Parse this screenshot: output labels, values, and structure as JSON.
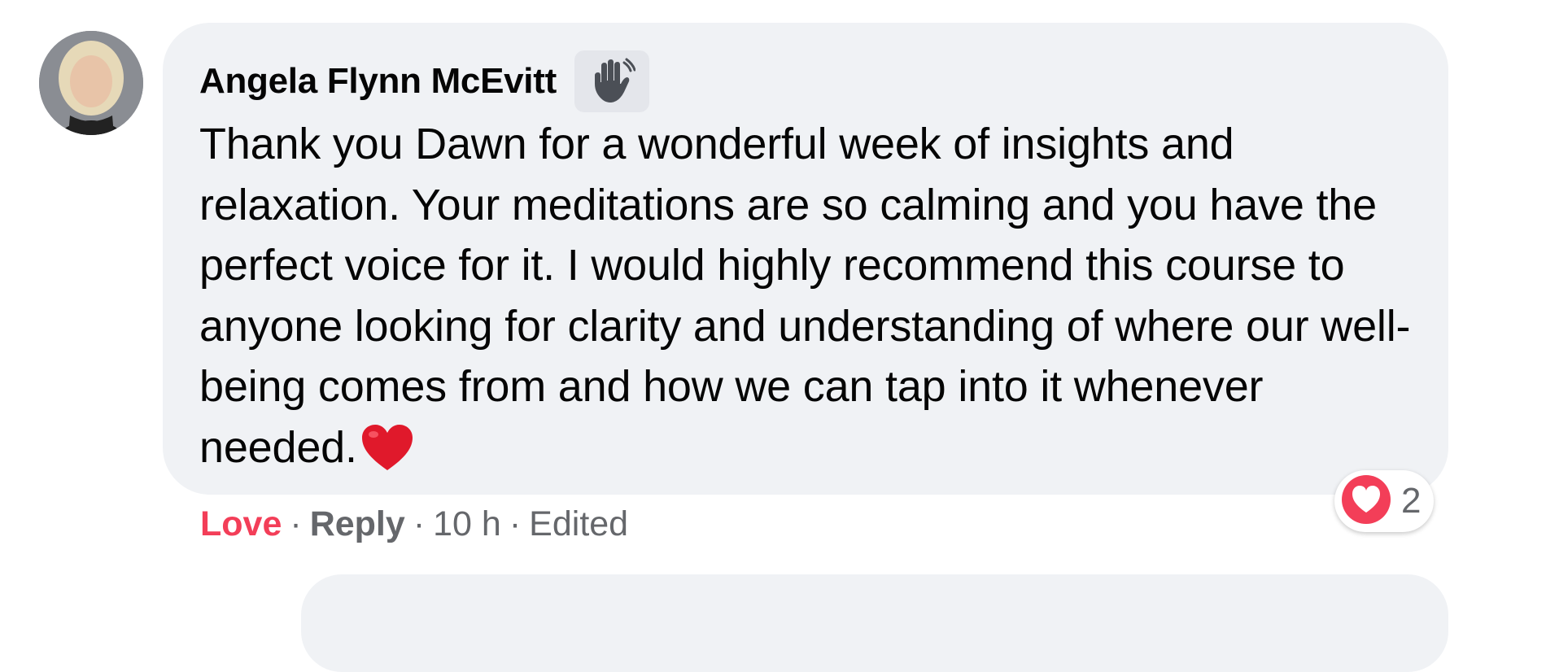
{
  "comment": {
    "author": "Angela Flynn McEvitt",
    "badge_icon": "waving-hand-icon",
    "text": "Thank you Dawn for a wonderful week of insights and relaxation. Your meditations are so calming and you have the perfect voice for it. I would highly recommend this course to anyone looking for clarity and understanding of where our well-being comes from and how we can tap into it whenever needed.",
    "inline_emoji": "red-heart-icon"
  },
  "reactions": {
    "icon": "love-reaction-icon",
    "count": "2"
  },
  "actions": {
    "love_label": "Love",
    "separator": "·",
    "reply_label": "Reply",
    "time": "10 h",
    "edited_label": "Edited"
  },
  "colors": {
    "bubble_bg": "#f0f2f5",
    "love_red": "#f33e58",
    "meta_gray": "#65676b"
  }
}
